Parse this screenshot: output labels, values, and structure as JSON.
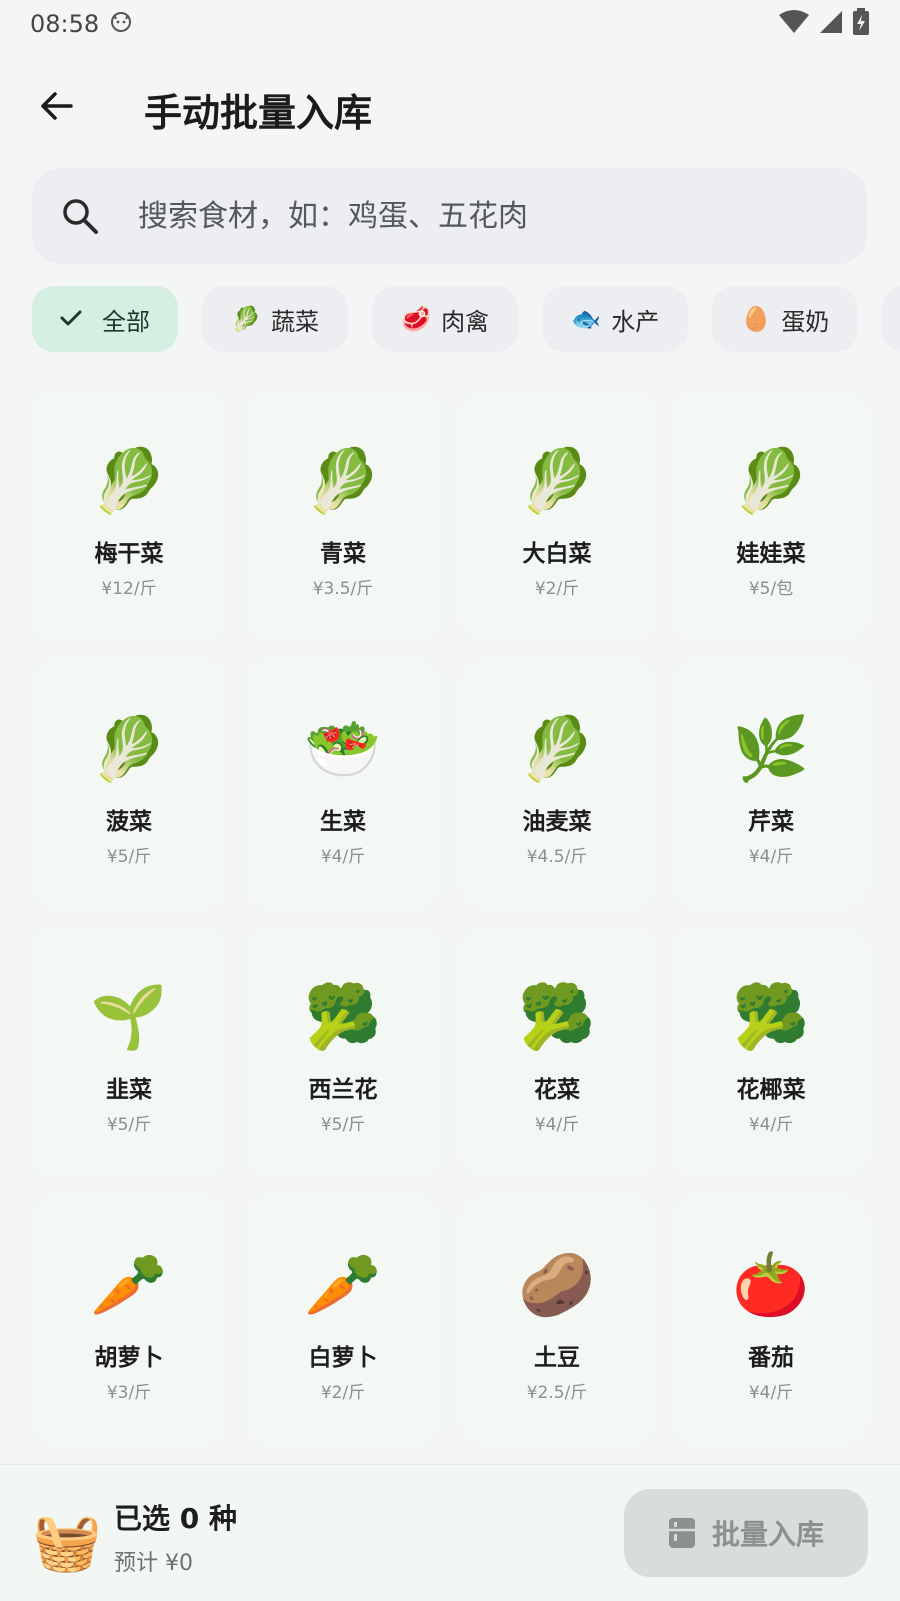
{
  "status": {
    "time": "08:58"
  },
  "header": {
    "title": "手动批量入库"
  },
  "search": {
    "placeholder": "搜索食材，如：鸡蛋、五花肉"
  },
  "categories": [
    {
      "label": "全部",
      "icon": "check-icon",
      "active": true
    },
    {
      "label": "蔬菜",
      "icon": "🥬"
    },
    {
      "label": "肉禽",
      "icon": "🥩"
    },
    {
      "label": "水产",
      "icon": "🐟"
    },
    {
      "label": "蛋奶",
      "icon": "🥚"
    },
    {
      "label": "",
      "icon": "🍅"
    }
  ],
  "items": [
    {
      "name": "梅干菜",
      "price": "¥12/斤",
      "emoji": "🥬"
    },
    {
      "name": "青菜",
      "price": "¥3.5/斤",
      "emoji": "🥬"
    },
    {
      "name": "大白菜",
      "price": "¥2/斤",
      "emoji": "🥬"
    },
    {
      "name": "娃娃菜",
      "price": "¥5/包",
      "emoji": "🥬"
    },
    {
      "name": "菠菜",
      "price": "¥5/斤",
      "emoji": "🥬"
    },
    {
      "name": "生菜",
      "price": "¥4/斤",
      "emoji": "🥗"
    },
    {
      "name": "油麦菜",
      "price": "¥4.5/斤",
      "emoji": "🥬"
    },
    {
      "name": "芹菜",
      "price": "¥4/斤",
      "emoji": "🌿"
    },
    {
      "name": "韭菜",
      "price": "¥5/斤",
      "emoji": "🌱"
    },
    {
      "name": "西兰花",
      "price": "¥5/斤",
      "emoji": "🥦"
    },
    {
      "name": "花菜",
      "price": "¥4/斤",
      "emoji": "🥦"
    },
    {
      "name": "花椰菜",
      "price": "¥4/斤",
      "emoji": "🥦"
    },
    {
      "name": "胡萝卜",
      "price": "¥3/斤",
      "emoji": "🥕"
    },
    {
      "name": "白萝卜",
      "price": "¥2/斤",
      "emoji": "🥕"
    },
    {
      "name": "土豆",
      "price": "¥2.5/斤",
      "emoji": "🥔"
    },
    {
      "name": "番茄",
      "price": "¥4/斤",
      "emoji": "🍅"
    }
  ],
  "footer": {
    "selected": "已选 0 种",
    "estimate": "预计 ¥0",
    "basket_icon": "🧺",
    "batch_label": "批量入库"
  },
  "colors": {
    "accent_chip": "#d5efe2",
    "card_bg": "#f3f8f5",
    "disabled_btn": "#d9ddda"
  }
}
